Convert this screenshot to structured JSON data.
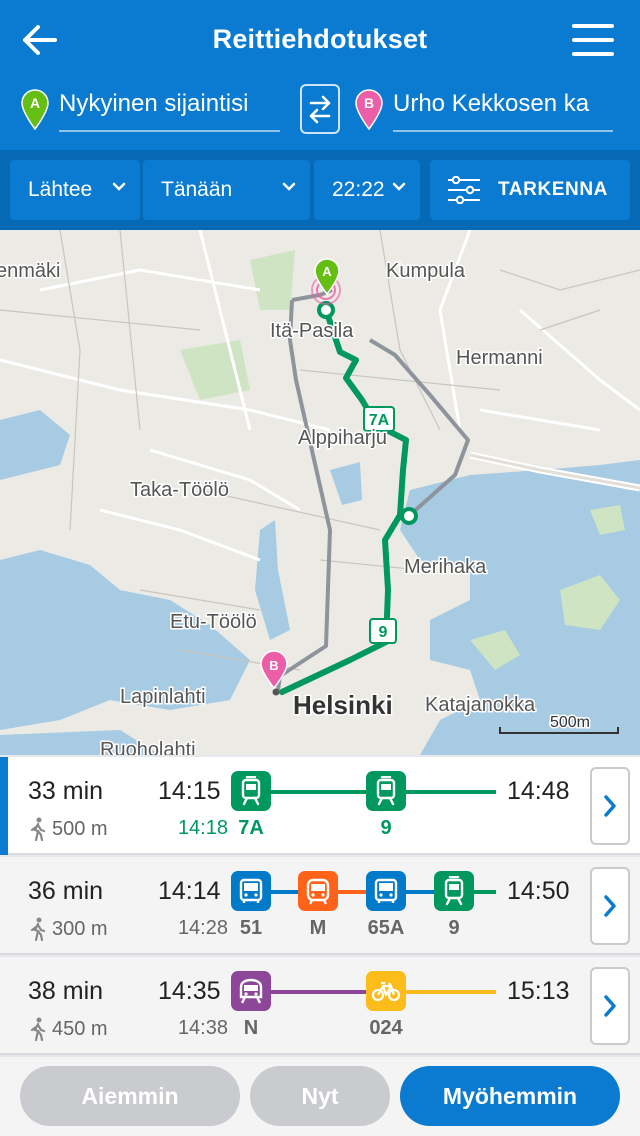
{
  "header": {
    "title": "Reittiehdotukset",
    "from": "Nykyinen sijaintisi",
    "to": "Urho Kekkosen ka",
    "pin_a": "A",
    "pin_b": "B"
  },
  "filters": {
    "depart": "Lähtee",
    "day": "Tänään",
    "time": "22:22",
    "refine": "TARKENNA"
  },
  "map": {
    "places": [
      "enmäki",
      "Kumpula",
      "Itä-Pasila",
      "Hermanni",
      "Alppiharju",
      "Taka-Töölö",
      "Merihaka",
      "Etu-Töölö",
      "Lapinlahti",
      "Helsinki",
      "Katajanokka",
      "Ruoholahti"
    ],
    "route_labels": [
      "7A",
      "9"
    ],
    "scale": "500m",
    "pin_a": "A",
    "pin_b": "B"
  },
  "routes": [
    {
      "duration": "33 min",
      "walk": "500 m",
      "depart": "14:15",
      "stop_time": "14:18",
      "arrive": "14:48",
      "legs": [
        {
          "mode": "tram",
          "label": "7A"
        },
        {
          "mode": "tram",
          "label": "9"
        }
      ]
    },
    {
      "duration": "36 min",
      "walk": "300 m",
      "depart": "14:14",
      "stop_time": "14:28",
      "arrive": "14:50",
      "legs": [
        {
          "mode": "bus",
          "label": "51"
        },
        {
          "mode": "metro",
          "label": "M"
        },
        {
          "mode": "bus",
          "label": "65A"
        },
        {
          "mode": "tram",
          "label": "9"
        }
      ]
    },
    {
      "duration": "38 min",
      "walk": "450 m",
      "depart": "14:35",
      "stop_time": "14:38",
      "arrive": "15:13",
      "legs": [
        {
          "mode": "train",
          "label": "N"
        },
        {
          "mode": "citybike",
          "label": "024"
        }
      ]
    }
  ],
  "nav": {
    "earlier": "Aiemmin",
    "now": "Nyt",
    "later": "Myöhemmin"
  },
  "colors": {
    "primary": "#0a7bd1",
    "tram": "#00985f",
    "bus": "#007ac9",
    "metro": "#ff6319",
    "train": "#8c4799",
    "citybike": "#fcbc19"
  }
}
